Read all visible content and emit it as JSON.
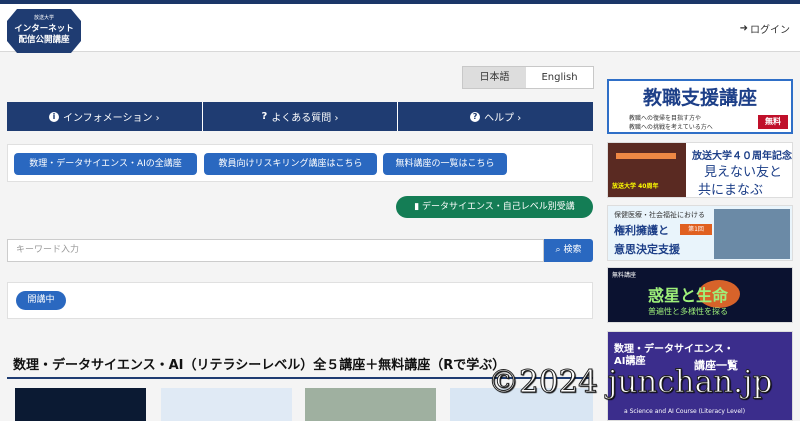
{
  "header": {
    "logo_small": "放送大学",
    "logo_line1": "インターネット",
    "logo_line2": "配信公開講座",
    "login_label": "ログイン"
  },
  "lang": {
    "ja": "日本語",
    "en": "English"
  },
  "nav": [
    {
      "icon": "info-icon",
      "label": "インフォメーション ›"
    },
    {
      "icon": "question-icon",
      "label": "よくある質問 ›"
    },
    {
      "icon": "help-icon",
      "label": "ヘルプ ›"
    }
  ],
  "quick_buttons": [
    "数理・データサイエンス・AIの全講座",
    "教員向けリスキリング講座はこちら",
    "無料講座の一覧はこちら"
  ],
  "green_button": "データサイエンス・自己レベル別受講",
  "search": {
    "placeholder": "キーワード入力",
    "button": "検索"
  },
  "status": {
    "label": "開講中"
  },
  "section": {
    "title": "数理・データサイエンス・AI（リテラシーレベル）全５講座＋無料講座（Rで学ぶ）"
  },
  "banners": {
    "b1": {
      "title": "教職支援講座",
      "sub1": "教職への復帰を目指す方や",
      "sub2": "教職への挑戦を考えている方へ",
      "badge": "無料"
    },
    "b2": {
      "r1": "放送大学４０周年記念",
      "r2": "見えない友と",
      "r3": "共にまなぶ",
      "photo_label": "放送大学 40周年"
    },
    "b3": {
      "l1": "保健医療・社会福祉における",
      "l2": "権利擁護と",
      "l3": "意思決定支援",
      "tag": "第1回"
    },
    "b4": {
      "l1": "無料講座",
      "l2": "惑星と生命",
      "l3": "普遍性と多様性を探る"
    },
    "b5": {
      "l1": "数理・データサイエンス・",
      "l2": "AI講座",
      "l3": "講座一覧",
      "l4": "a Science and AI Course (Literacy Level)"
    }
  },
  "watermark": "©2024 junchan.jp",
  "colors": {
    "navy": "#1f3c72",
    "blue": "#2a68c0",
    "green": "#147d55"
  }
}
